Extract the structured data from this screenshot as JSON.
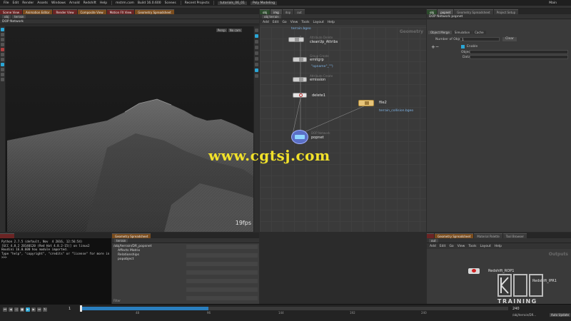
{
  "menubar": {
    "items": [
      "File",
      "Edit",
      "Render",
      "Assets",
      "Windows",
      "Arnold",
      "Redshift",
      "Help"
    ],
    "desktop": "mstrm.com",
    "build": "Build 16.0.600",
    "scenes": "Scenes",
    "recent": "Recent Projects",
    "file_tab": "tutorials_06_01",
    "tool_tab": "Poly Modeling",
    "workspace": "Main"
  },
  "left_tabs": [
    "Scene View",
    "Animation Editor",
    "Render View",
    "Composite View",
    "Motion FX View",
    "Geometry Spreadsheet"
  ],
  "viewport": {
    "path_chip": "obj",
    "context_chip": "terrain",
    "network_label": "DOP Network",
    "persp_btn": "Persp",
    "cam_btn": "No cam",
    "fps": "19fps"
  },
  "network": {
    "tabs": [
      "obj",
      "img",
      "dop",
      "out"
    ],
    "path": "obj  terrain",
    "menu": [
      "Add",
      "Edit",
      "Go",
      "View",
      "Tools",
      "Layout",
      "Help"
    ],
    "context": "Geometry",
    "nodes": {
      "n1_note": "terrain.bgeo",
      "n2_type": "Attribute Delete",
      "n2_label": "cleanUp_Attribs",
      "n3_type": "Group Create",
      "n3_label": "emitgrp",
      "n3_note": "\"opname\"_\"\")",
      "n4_type": "Attribute Create",
      "n4_label": "emission",
      "n5_label": "delete1",
      "file_label": "file2",
      "file_note": "terrain_collision.bgeo",
      "dop_type": "DOP Network",
      "dop_label": "popnet"
    }
  },
  "parms": {
    "tabs": [
      "obj",
      "popnet",
      "Geometry Spreadsheet",
      "Project Setup"
    ],
    "header": "DOP Network  popnet",
    "sub_tabs": [
      "Object Merge",
      "Simulation",
      "Cache"
    ],
    "number_objects_label": "Number of Objects",
    "number_objects_value": "1",
    "clear_btn": "Clear",
    "enable_label": "Enable",
    "object_label": "Object",
    "data_label": "Data"
  },
  "python": {
    "lines": [
      "Python 2.7.5 (default, Nov  4 2016, 12:56:54)",
      "[GCC 4.8.2 20140120 (Red Hat 4.8.2-15)] on linux2",
      "Houdini 16.0.600 hou module imported.",
      "Type \"help\", \"copyright\", \"credits\" or \"license\" for more in",
      ">>>"
    ]
  },
  "tree": {
    "tabs": [
      "Geometry Spreadsheet"
    ],
    "path_chip": "terrain",
    "rows": [
      "/obj/terrain/DR_popsnet",
      "Affects Matrix",
      "Relationships",
      "popobject"
    ],
    "filter": "Filter"
  },
  "outputs": {
    "tabs": [
      "",
      "Geometry Spreadsheet",
      "Material Palette",
      "Tool Browser"
    ],
    "path": "out",
    "menu": [
      "Add",
      "Edit",
      "Go",
      "View",
      "Tools",
      "Layout",
      "Help"
    ],
    "context": "Outputs",
    "rop1": "Redshift_ROP1",
    "rop2": "Redshift_IPR1"
  },
  "timeline": {
    "frame": "1",
    "ticks": [
      "48",
      "96",
      "144",
      "192",
      "240"
    ],
    "end": "240",
    "status": "/obj/terrain/DR...",
    "autoupdate": "Auto Update"
  },
  "watermark": "www.cgtsj.com",
  "logo_text": "TRAINING",
  "colors": {
    "accent": "#2aa6d6",
    "watermark": "#f2e22a",
    "node_file": "#e7c57a",
    "dop_node": "#5a6fc6"
  }
}
